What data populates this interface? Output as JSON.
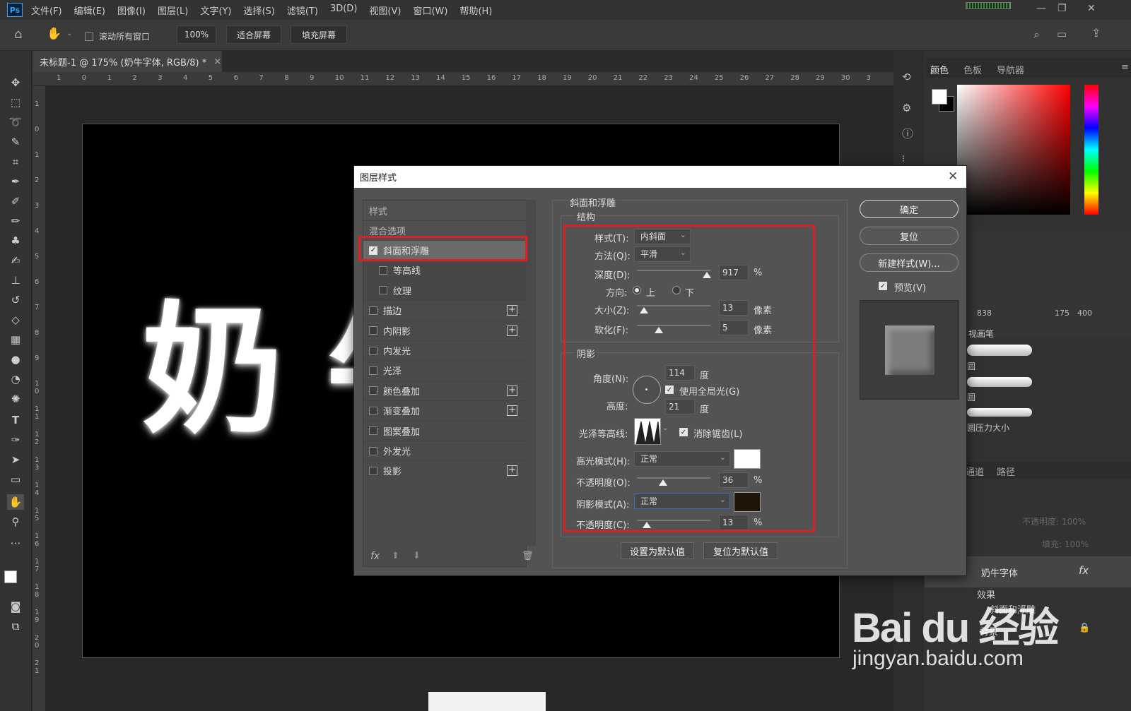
{
  "app": {
    "logo": "Ps"
  },
  "menu": [
    "文件(F)",
    "编辑(E)",
    "图像(I)",
    "图层(L)",
    "文字(Y)",
    "选择(S)",
    "滤镜(T)",
    "3D(D)",
    "视图(V)",
    "窗口(W)",
    "帮助(H)"
  ],
  "options": {
    "scroll_all": "滚动所有窗口",
    "zoom": "100%",
    "fit_screen": "适合屏幕",
    "fill_screen": "填充屏幕"
  },
  "document": {
    "tab_title": "未标题-1 @ 175% (奶牛字体, RGB/8) *",
    "canvas_text": "奶牛"
  },
  "ruler": {
    "top": [
      "1",
      "0",
      "1",
      "2",
      "3",
      "4",
      "5",
      "6",
      "7",
      "8",
      "9",
      "10",
      "11",
      "12",
      "13",
      "14",
      "15",
      "16",
      "17",
      "18",
      "19",
      "20",
      "21",
      "22",
      "23",
      "24",
      "25",
      "26",
      "27",
      "28",
      "29",
      "30",
      "3"
    ],
    "left": [
      "1",
      "0",
      "1",
      "2",
      "3",
      "4",
      "5",
      "6",
      "7",
      "8",
      "9",
      "1 0",
      "1 1",
      "1 2",
      "1 3",
      "1 4",
      "1 5",
      "1 6",
      "1 7",
      "1 8",
      "1 9",
      "2 0",
      "2 1"
    ]
  },
  "right_panel": {
    "tabs": [
      "颜色",
      "色板",
      "导航器"
    ],
    "brush_sizes": [
      "838",
      "175",
      "400"
    ],
    "brush_labels": [
      "视画笔",
      "圆",
      "圆",
      "圆压力大小"
    ],
    "layer_tabs": [
      "通道",
      "路径"
    ],
    "opacity_label": "不透明度: 100%",
    "fill_label": "填充: 100%",
    "layer_name": "奶牛字体",
    "effects_label": "效果",
    "effect_item": "斜面和浮雕",
    "bg_label": "背景"
  },
  "dialog": {
    "title": "图层样式",
    "left": {
      "styles": "样式",
      "blend": "混合选项",
      "items": [
        {
          "label": "斜面和浮雕",
          "checked": true,
          "plus": false,
          "indent": false
        },
        {
          "label": "等高线",
          "checked": false,
          "plus": false,
          "indent": true
        },
        {
          "label": "纹理",
          "checked": false,
          "plus": false,
          "indent": true
        },
        {
          "label": "描边",
          "checked": false,
          "plus": true,
          "indent": false
        },
        {
          "label": "内阴影",
          "checked": false,
          "plus": true,
          "indent": false
        },
        {
          "label": "内发光",
          "checked": false,
          "plus": false,
          "indent": false
        },
        {
          "label": "光泽",
          "checked": false,
          "plus": false,
          "indent": false
        },
        {
          "label": "颜色叠加",
          "checked": false,
          "plus": true,
          "indent": false
        },
        {
          "label": "渐变叠加",
          "checked": false,
          "plus": true,
          "indent": false
        },
        {
          "label": "图案叠加",
          "checked": false,
          "plus": false,
          "indent": false
        },
        {
          "label": "外发光",
          "checked": false,
          "plus": false,
          "indent": false
        },
        {
          "label": "投影",
          "checked": false,
          "plus": true,
          "indent": false
        }
      ],
      "fx": "fx"
    },
    "section_title": "斜面和浮雕",
    "structure": {
      "title": "结构",
      "style_label": "样式(T):",
      "style_value": "内斜面",
      "technique_label": "方法(Q):",
      "technique_value": "平滑",
      "depth_label": "深度(D):",
      "depth_value": "917",
      "depth_unit": "%",
      "depth_fraction": 0.95,
      "direction_label": "方向:",
      "dir_up": "上",
      "dir_down": "下",
      "size_label": "大小(Z):",
      "size_value": "13",
      "size_unit": "像素",
      "size_fraction": 0.1,
      "soften_label": "软化(F):",
      "soften_value": "5",
      "soften_unit": "像素",
      "soften_fraction": 0.3
    },
    "shading": {
      "title": "阴影",
      "angle_label": "角度(N):",
      "angle_value": "114",
      "angle_unit": "度",
      "global_light": "使用全局光(G)",
      "altitude_label": "高度:",
      "altitude_value": "21",
      "altitude_unit": "度",
      "gloss_label": "光泽等高线:",
      "anti_alias": "消除锯齿(L)",
      "highlight_label": "高光模式(H):",
      "highlight_mode": "正常",
      "highlight_color": "#ffffff",
      "hl_opacity_label": "不透明度(O):",
      "hl_opacity": "36",
      "hl_unit": "%",
      "hl_fraction": 0.36,
      "shadow_label": "阴影模式(A):",
      "shadow_mode": "正常",
      "shadow_color": "#1e1408",
      "sh_opacity_label": "不透明度(C):",
      "sh_opacity": "13",
      "sh_unit": "%",
      "sh_fraction": 0.13
    },
    "buttons": {
      "ok": "确定",
      "reset": "复位",
      "new_style": "新建样式(W)...",
      "preview": "预览(V)",
      "make_default": "设置为默认值",
      "reset_default": "复位为默认值"
    }
  },
  "watermark": {
    "brand": "Bai du 经验",
    "url": "jingyan.baidu.com"
  }
}
